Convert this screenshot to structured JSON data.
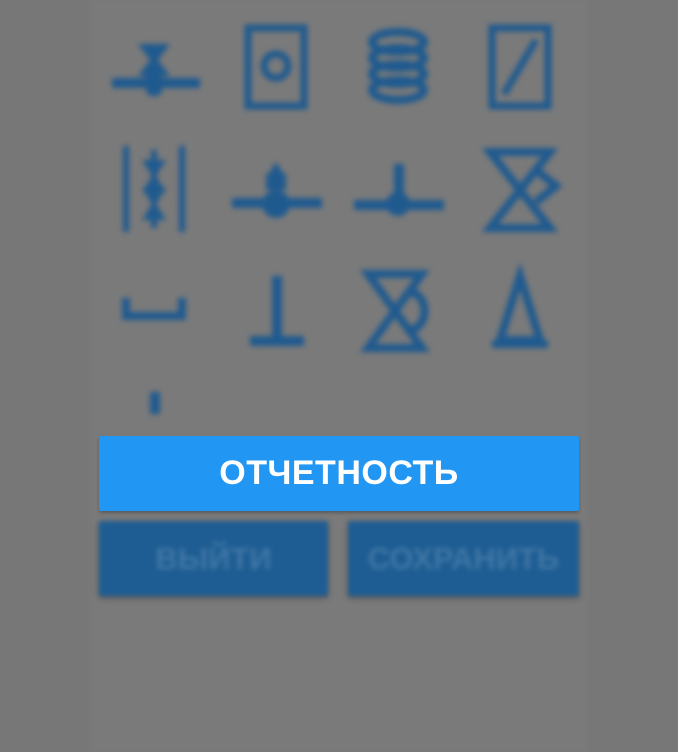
{
  "colors": {
    "overlay": "#777777",
    "accent": "#2196f3",
    "dimmed_accent": "#1e5d93",
    "symbol": "#1f5a8f"
  },
  "symbols": [
    {
      "name": "valve-tee-icon"
    },
    {
      "name": "meter-box-icon"
    },
    {
      "name": "coil-icon"
    },
    {
      "name": "panel-slash-icon"
    },
    {
      "name": "inline-double-valve-icon"
    },
    {
      "name": "valve-on-line-icon"
    },
    {
      "name": "tee-junction-icon"
    },
    {
      "name": "three-way-valve-icon"
    },
    {
      "name": "bracket-icon"
    },
    {
      "name": "inverted-tee-icon"
    },
    {
      "name": "angle-valve-icon"
    },
    {
      "name": "cone-icon"
    },
    {
      "name": "short-line-icon"
    }
  ],
  "actions": {
    "report_label": "ОТЧЕТНОСТЬ",
    "exit_label": "ВЫЙТИ",
    "save_label": "СОХРАНИТЬ"
  }
}
